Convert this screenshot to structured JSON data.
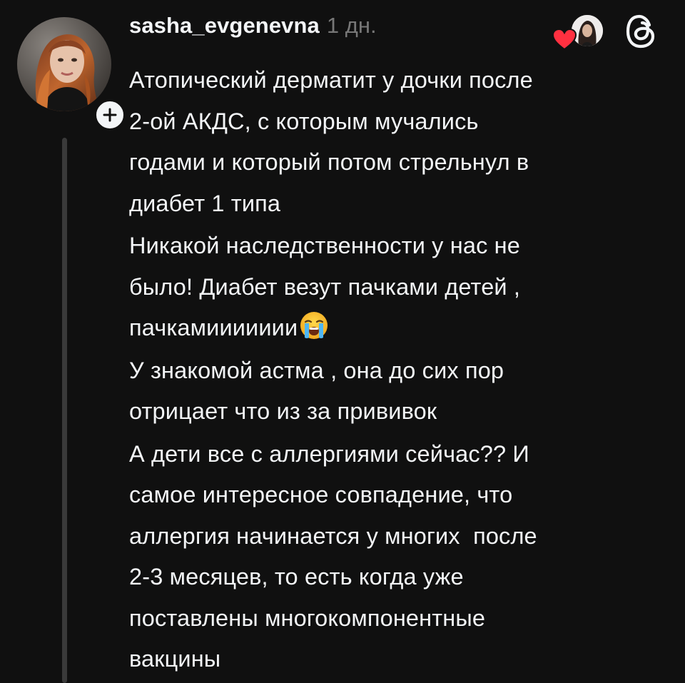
{
  "post": {
    "username": "sasha_evgenevna",
    "time": "1 дн.",
    "author_avatar": "author-avatar",
    "follow_icon": "plus-icon",
    "liked_by_icon": "heart-icon",
    "app_icon": "threads-logo-icon",
    "paragraphs": [
      {
        "text": "Атопический дерматит у дочки после\n2-ой АКДС, с которым мучались\nгодами и который потом стрельнул в\nдиабет 1 типа"
      },
      {
        "text": "Никакой наследственности у нас не\nбыло! Диабет везут пачками детей ,\nпачкамиииииии",
        "emoji": "loudly-crying-face-emoji"
      },
      {
        "text": "У знакомой астма , она до сих пор\nотрицает что из за прививок"
      },
      {
        "text": "А дети все с аллергиями сейчас?? И\nсамое интересное совпадение, что\nаллергия начинается у многих  после\n2-3 месяцев, то есть когда уже\nпоставлены многокомпонентные\nвакцины"
      }
    ]
  },
  "colors": {
    "background": "#101010",
    "text": "#f3f5f7",
    "secondary_text": "#777777",
    "thread_line": "#3a3a3a",
    "heart": "#ff3040"
  }
}
